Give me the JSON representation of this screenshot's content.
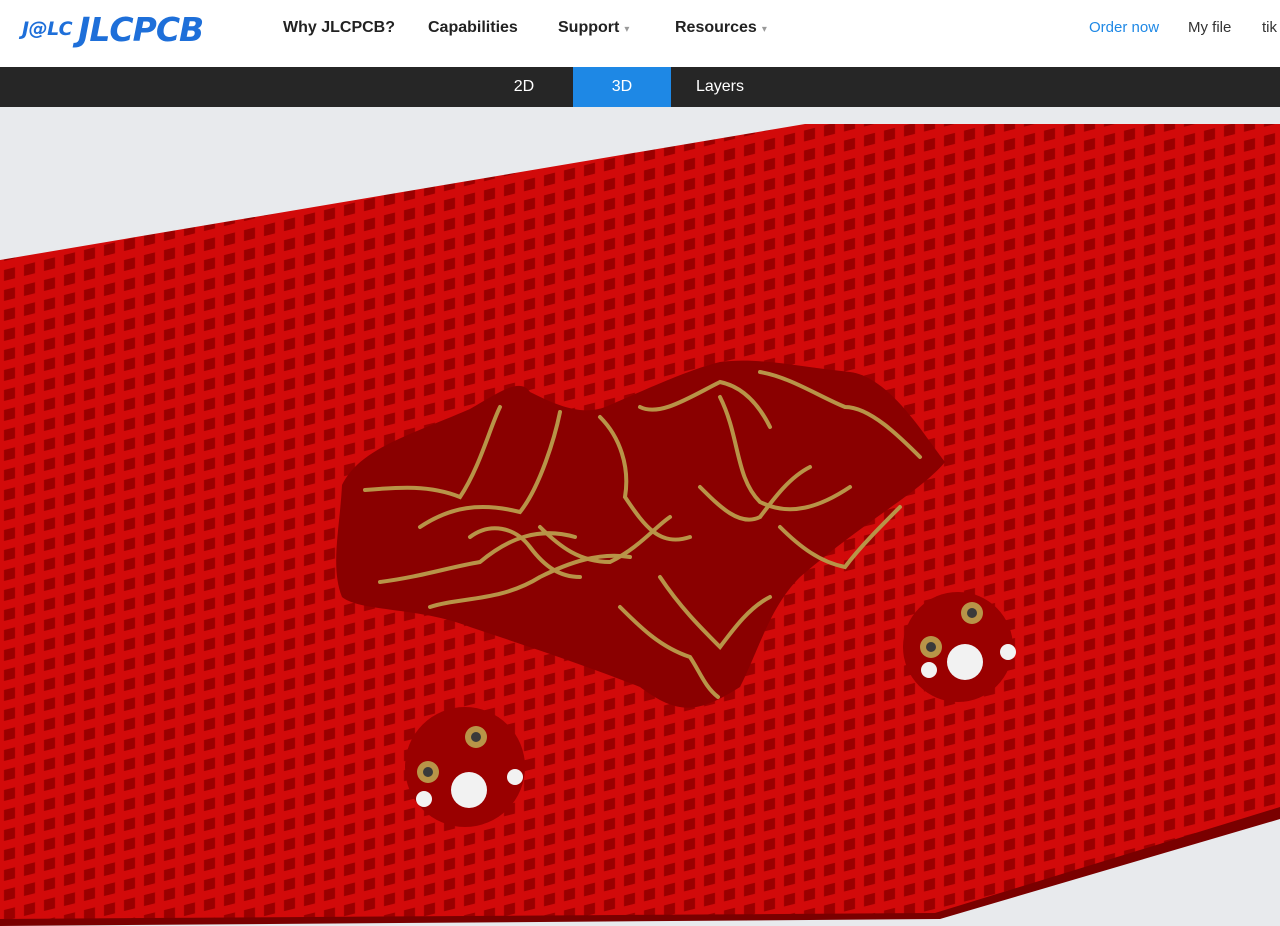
{
  "brand": {
    "badge": "J@LC",
    "name": "JLCPCB",
    "color": "#1e6fd9"
  },
  "nav": {
    "items": [
      {
        "label": "Why JLCPCB?",
        "has_dropdown": false
      },
      {
        "label": "Capabilities",
        "has_dropdown": false
      },
      {
        "label": "Support",
        "has_dropdown": true
      },
      {
        "label": "Resources",
        "has_dropdown": true
      }
    ],
    "order_now": "Order now",
    "my_file": "My file",
    "user_partial": "tik"
  },
  "view_tabs": [
    {
      "label": "2D",
      "active": false
    },
    {
      "label": "3D",
      "active": true
    },
    {
      "label": "Layers",
      "active": false
    }
  ],
  "board_render": {
    "board_color": "#cc0000",
    "copper_color": "#b89448",
    "accent_color": "#1e88e5"
  }
}
